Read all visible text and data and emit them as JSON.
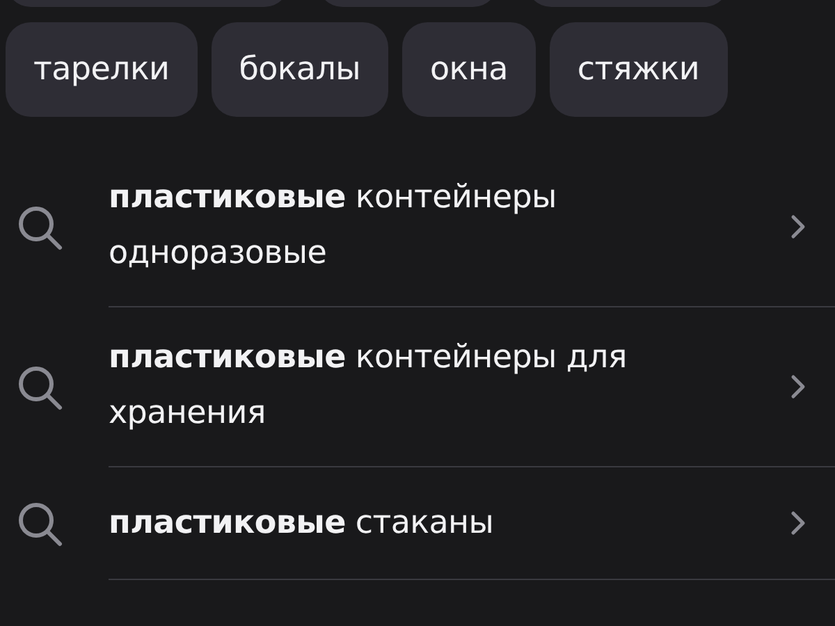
{
  "chips": [
    {
      "label": "тарелки"
    },
    {
      "label": "бокалы"
    },
    {
      "label": "окна"
    },
    {
      "label": "стяжки"
    }
  ],
  "suggestions": [
    {
      "text": "**пластиковые** контейнеры одноразовые"
    },
    {
      "text": "**пластиковые** контейнеры для хранения"
    },
    {
      "text": "**пластиковые** стаканы"
    }
  ]
}
